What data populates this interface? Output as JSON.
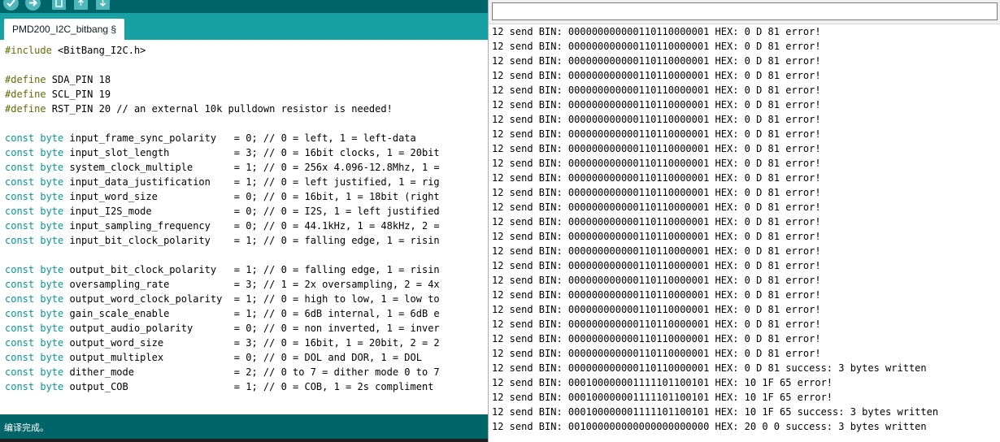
{
  "toolbar": {
    "buttons": [
      {
        "name": "verify",
        "icon": "check-icon"
      },
      {
        "name": "upload",
        "icon": "arrow-right-icon"
      },
      {
        "name": "new",
        "icon": "new-file-icon"
      },
      {
        "name": "open",
        "icon": "open-arrow-icon"
      },
      {
        "name": "save",
        "icon": "save-arrow-icon"
      }
    ]
  },
  "tab": {
    "label": "PMD200_I2C_bitbang §"
  },
  "code_lines": [
    [
      {
        "t": "#include",
        "c": "kw-pp"
      },
      {
        "t": " <BitBang_I2C.h>"
      }
    ],
    [],
    [
      {
        "t": "#define",
        "c": "kw-pp"
      },
      {
        "t": " SDA_PIN 18"
      }
    ],
    [
      {
        "t": "#define",
        "c": "kw-pp"
      },
      {
        "t": " SCL_PIN 19"
      }
    ],
    [
      {
        "t": "#define",
        "c": "kw-pp"
      },
      {
        "t": " RST_PIN 20 // an external 10k pulldown resistor is needed!"
      }
    ],
    [],
    [
      {
        "t": "const",
        "c": "kw-type"
      },
      {
        "t": " "
      },
      {
        "t": "byte",
        "c": "kw-type"
      },
      {
        "t": " input_frame_sync_polarity   = 0; // 0 = left, 1 = left-data"
      }
    ],
    [
      {
        "t": "const",
        "c": "kw-type"
      },
      {
        "t": " "
      },
      {
        "t": "byte",
        "c": "kw-type"
      },
      {
        "t": " input_slot_length           = 3; // 0 = 16bit clocks, 1 = 20bit"
      }
    ],
    [
      {
        "t": "const",
        "c": "kw-type"
      },
      {
        "t": " "
      },
      {
        "t": "byte",
        "c": "kw-type"
      },
      {
        "t": " system_clock_multiple       = 1; // 0 = 256x 4.096-12.8Mhz, 1 ="
      }
    ],
    [
      {
        "t": "const",
        "c": "kw-type"
      },
      {
        "t": " "
      },
      {
        "t": "byte",
        "c": "kw-type"
      },
      {
        "t": " input_data_justification    = 1; // 0 = left justified, 1 = rig"
      }
    ],
    [
      {
        "t": "const",
        "c": "kw-type"
      },
      {
        "t": " "
      },
      {
        "t": "byte",
        "c": "kw-type"
      },
      {
        "t": " input_word_size             = 0; // 0 = 16bit, 1 = 18bit (right"
      }
    ],
    [
      {
        "t": "const",
        "c": "kw-type"
      },
      {
        "t": " "
      },
      {
        "t": "byte",
        "c": "kw-type"
      },
      {
        "t": " input_I2S_mode              = 0; // 0 = I2S, 1 = left justified"
      }
    ],
    [
      {
        "t": "const",
        "c": "kw-type"
      },
      {
        "t": " "
      },
      {
        "t": "byte",
        "c": "kw-type"
      },
      {
        "t": " input_sampling_frequency    = 0; // 0 = 44.1kHz, 1 = 48kHz, 2 ="
      }
    ],
    [
      {
        "t": "const",
        "c": "kw-type"
      },
      {
        "t": " "
      },
      {
        "t": "byte",
        "c": "kw-type"
      },
      {
        "t": " input_bit_clock_polarity    = 1; // 0 = falling edge, 1 = risin"
      }
    ],
    [],
    [
      {
        "t": "const",
        "c": "kw-type"
      },
      {
        "t": " "
      },
      {
        "t": "byte",
        "c": "kw-type"
      },
      {
        "t": " output_bit_clock_polarity   = 1; // 0 = falling edge, 1 = risin"
      }
    ],
    [
      {
        "t": "const",
        "c": "kw-type"
      },
      {
        "t": " "
      },
      {
        "t": "byte",
        "c": "kw-type"
      },
      {
        "t": " oversampling_rate           = 3; // 1 = 2x oversampling, 2 = 4x"
      }
    ],
    [
      {
        "t": "const",
        "c": "kw-type"
      },
      {
        "t": " "
      },
      {
        "t": "byte",
        "c": "kw-type"
      },
      {
        "t": " output_word_clock_polarity  = 1; // 0 = high to low, 1 = low to"
      }
    ],
    [
      {
        "t": "const",
        "c": "kw-type"
      },
      {
        "t": " "
      },
      {
        "t": "byte",
        "c": "kw-type"
      },
      {
        "t": " gain_scale_enable           = 1; // 0 = 6dB internal, 1 = 6dB e"
      }
    ],
    [
      {
        "t": "const",
        "c": "kw-type"
      },
      {
        "t": " "
      },
      {
        "t": "byte",
        "c": "kw-type"
      },
      {
        "t": " output_audio_polarity       = 0; // 0 = non inverted, 1 = inver"
      }
    ],
    [
      {
        "t": "const",
        "c": "kw-type"
      },
      {
        "t": " "
      },
      {
        "t": "byte",
        "c": "kw-type"
      },
      {
        "t": " output_word_size            = 3; // 0 = 16bit, 1 = 20bit, 2 = 2"
      }
    ],
    [
      {
        "t": "const",
        "c": "kw-type"
      },
      {
        "t": " "
      },
      {
        "t": "byte",
        "c": "kw-type"
      },
      {
        "t": " output_multiplex            = 0; // 0 = DOL and DOR, 1 = DOL"
      }
    ],
    [
      {
        "t": "const",
        "c": "kw-type"
      },
      {
        "t": " "
      },
      {
        "t": "byte",
        "c": "kw-type"
      },
      {
        "t": " dither_mode                 = 2; // 0 to 7 = dither mode 0 to 7"
      }
    ],
    [
      {
        "t": "const",
        "c": "kw-type"
      },
      {
        "t": " "
      },
      {
        "t": "byte",
        "c": "kw-type"
      },
      {
        "t": " output_COB                  = 1; // 0 = COB, 1 = 2s compliment"
      }
    ]
  ],
  "console": {
    "message": "编译完成。"
  },
  "serial": {
    "input_value": "",
    "lines": [
      "12 send BIN: 000000000000110110000001 HEX: 0 D 81 error!",
      "12 send BIN: 000000000000110110000001 HEX: 0 D 81 error!",
      "12 send BIN: 000000000000110110000001 HEX: 0 D 81 error!",
      "12 send BIN: 000000000000110110000001 HEX: 0 D 81 error!",
      "12 send BIN: 000000000000110110000001 HEX: 0 D 81 error!",
      "12 send BIN: 000000000000110110000001 HEX: 0 D 81 error!",
      "12 send BIN: 000000000000110110000001 HEX: 0 D 81 error!",
      "12 send BIN: 000000000000110110000001 HEX: 0 D 81 error!",
      "12 send BIN: 000000000000110110000001 HEX: 0 D 81 error!",
      "12 send BIN: 000000000000110110000001 HEX: 0 D 81 error!",
      "12 send BIN: 000000000000110110000001 HEX: 0 D 81 error!",
      "12 send BIN: 000000000000110110000001 HEX: 0 D 81 error!",
      "12 send BIN: 000000000000110110000001 HEX: 0 D 81 error!",
      "12 send BIN: 000000000000110110000001 HEX: 0 D 81 error!",
      "12 send BIN: 000000000000110110000001 HEX: 0 D 81 error!",
      "12 send BIN: 000000000000110110000001 HEX: 0 D 81 error!",
      "12 send BIN: 000000000000110110000001 HEX: 0 D 81 error!",
      "12 send BIN: 000000000000110110000001 HEX: 0 D 81 error!",
      "12 send BIN: 000000000000110110000001 HEX: 0 D 81 error!",
      "12 send BIN: 000000000000110110000001 HEX: 0 D 81 error!",
      "12 send BIN: 000000000000110110000001 HEX: 0 D 81 error!",
      "12 send BIN: 000000000000110110000001 HEX: 0 D 81 error!",
      "12 send BIN: 000000000000110110000001 HEX: 0 D 81 error!",
      "12 send BIN: 000000000000110110000001 HEX: 0 D 81 success: 3 bytes written",
      "12 send BIN: 000100000001111101100101 HEX: 10 1F 65 error!",
      "12 send BIN: 000100000001111101100101 HEX: 10 1F 65 error!",
      "12 send BIN: 000100000001111101100101 HEX: 10 1F 65 success: 3 bytes written",
      "12 send BIN: 001000000000000000000000 HEX: 20 0 0 success: 3 bytes written"
    ]
  },
  "colors": {
    "toolbar_bg": "#006468",
    "tab_strip_bg": "#17a1a5",
    "button_fill": "#4db7bb",
    "keyword_preprocessor": "#5e6d03",
    "keyword_type": "#00979c"
  }
}
